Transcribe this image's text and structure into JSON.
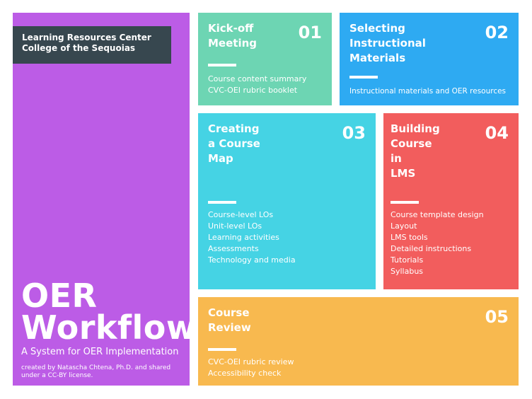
{
  "org": {
    "line1": "Learning Resources Center",
    "line2": "College of the Sequoias"
  },
  "main": {
    "title_line1": "OER",
    "title_line2": "Workflow",
    "subtitle": "A System for OER Implementation",
    "credit": "created by Natascha Chtena, Ph.D. and shared under a CC-BY license."
  },
  "cards": [
    {
      "num": "01",
      "title": [
        "Kick-off",
        "Meeting"
      ],
      "items": [
        "Course content summary",
        "CVC-OEI rubric booklet"
      ],
      "color": "#6dd5b3"
    },
    {
      "num": "02",
      "title": [
        "Selecting",
        "Instructional",
        "Materials"
      ],
      "items": [
        "Instructional materials and OER resources"
      ],
      "color": "#2eaaf2"
    },
    {
      "num": "03",
      "title": [
        "Creating",
        "a Course",
        "Map"
      ],
      "items": [
        "Course-level LOs",
        "Unit-level LOs",
        "Learning activities",
        "Assessments",
        "Technology and media"
      ],
      "color": "#45d3e4"
    },
    {
      "num": "04",
      "title": [
        "Building",
        "Course",
        "in",
        "LMS"
      ],
      "items": [
        "Course template design",
        "Layout",
        "LMS tools",
        "Detailed instructions",
        "Tutorials",
        "Syllabus"
      ],
      "color": "#f25d5d"
    },
    {
      "num": "05",
      "title": [
        "Course",
        "Review"
      ],
      "items": [
        "CVC-OEI rubric review",
        "Accessibility check"
      ],
      "color": "#f8b94f"
    }
  ],
  "left_panel_color": "#bc5ce6",
  "org_box_color": "#37474f"
}
